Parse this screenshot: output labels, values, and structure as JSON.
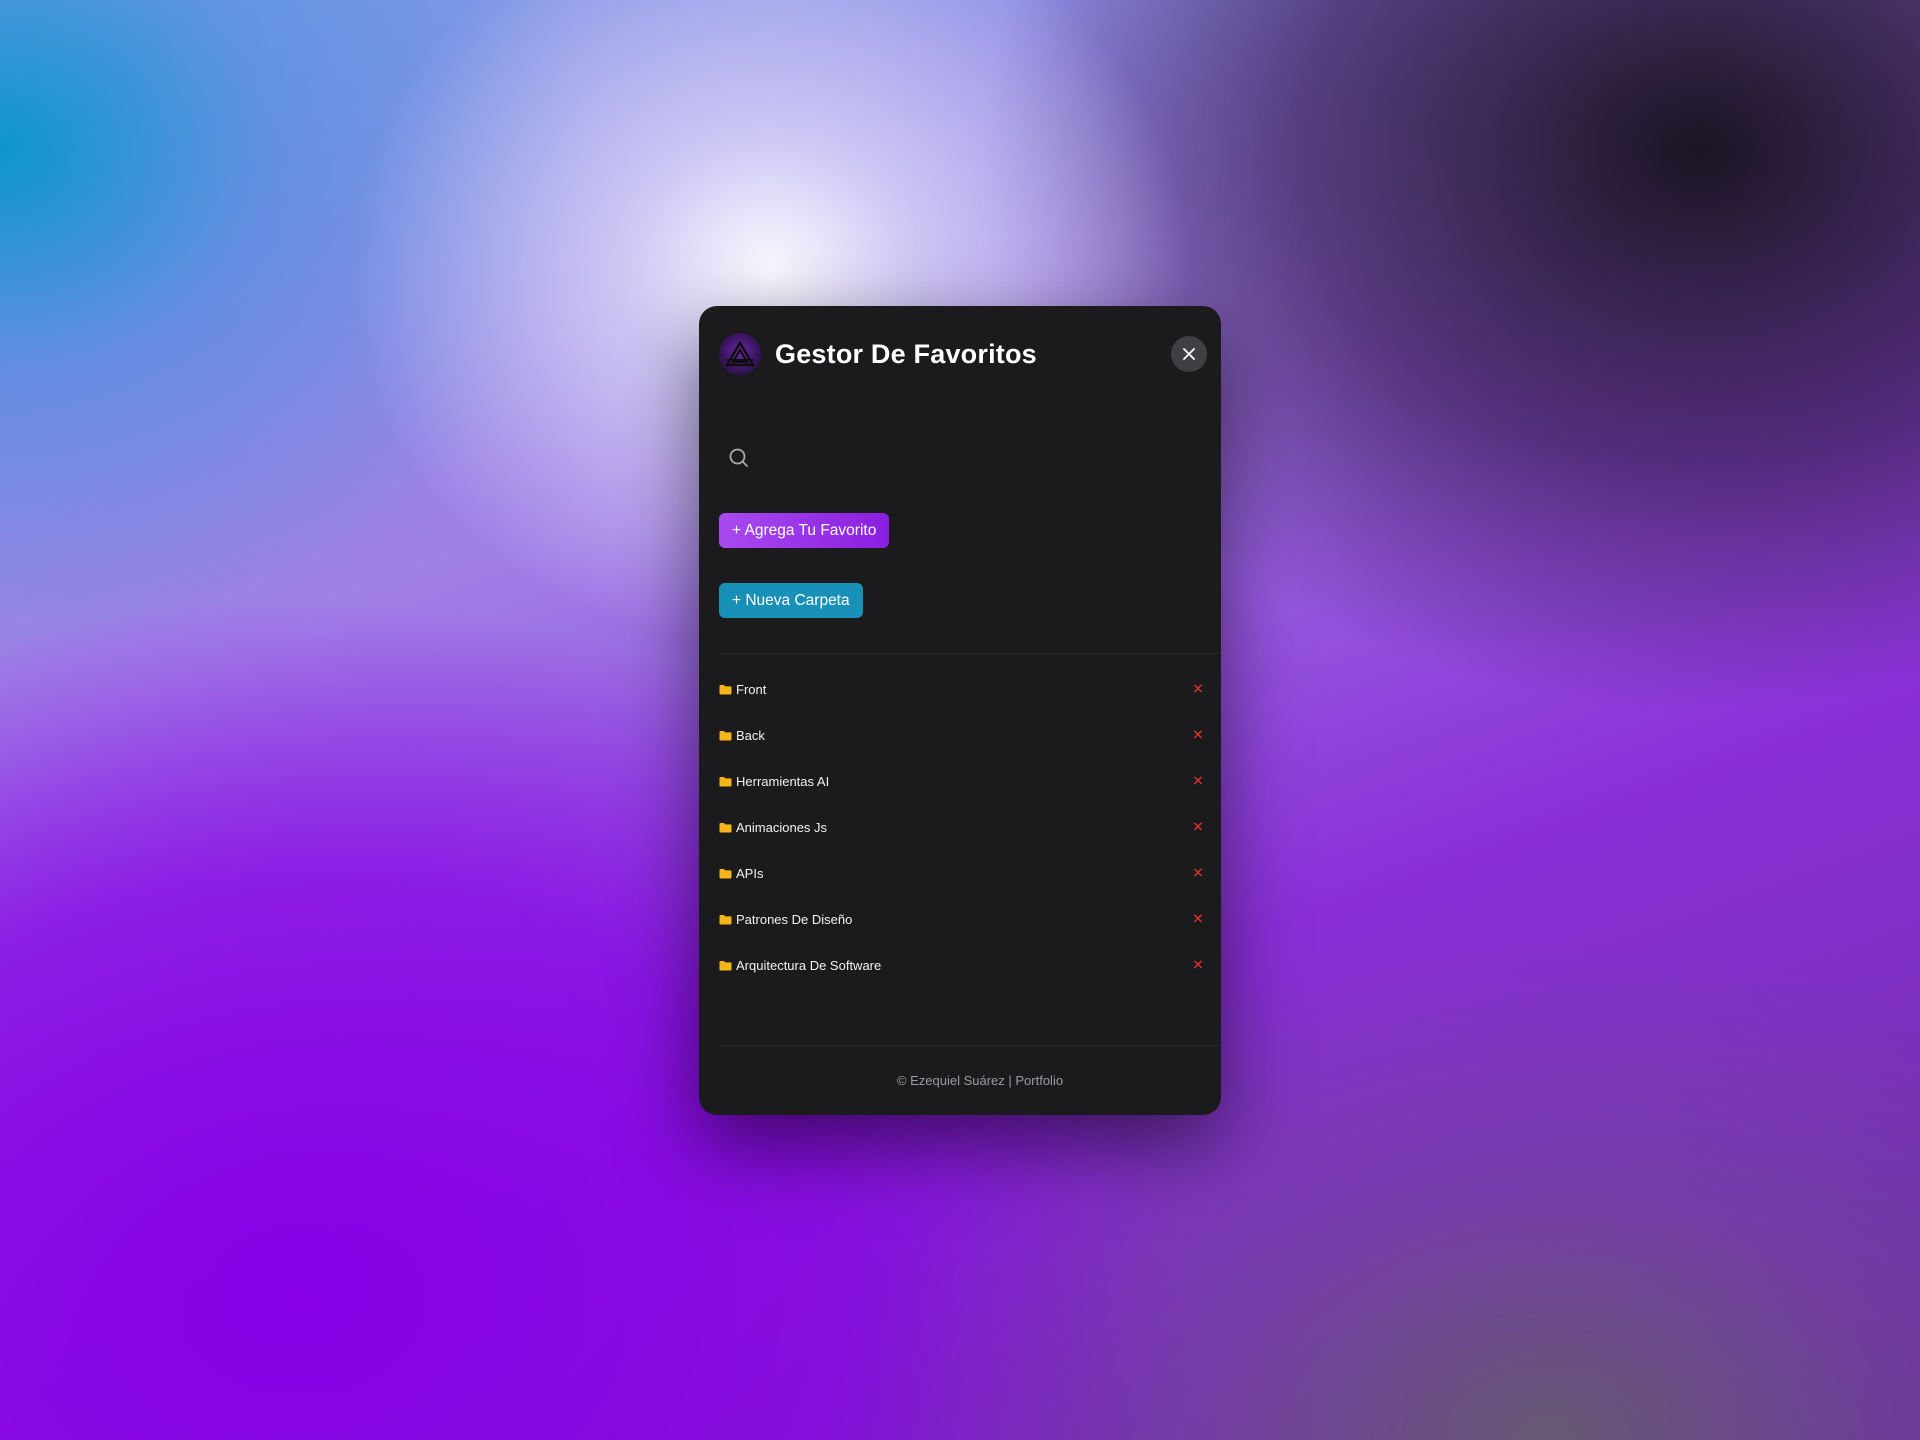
{
  "modal": {
    "title": "Gestor De Favoritos",
    "logo_icon": "triangle-logo-icon",
    "close_icon": "close-icon"
  },
  "search": {
    "placeholder": "",
    "value": "",
    "icon": "search-icon"
  },
  "actions": {
    "add_favorite_label": "+ Agrega Tu Favorito",
    "add_folder_label": "+ Nueva Carpeta"
  },
  "folders": [
    {
      "name": "Front"
    },
    {
      "name": "Back"
    },
    {
      "name": "Herramientas AI"
    },
    {
      "name": "Animaciones Js"
    },
    {
      "name": "APIs"
    },
    {
      "name": "Patrones De Diseño"
    },
    {
      "name": "Arquitectura De Software"
    }
  ],
  "folder_delete_label": "✕",
  "footer": {
    "copyright": "© Ezequiel Suárez",
    "separator": " | ",
    "link_label": "Portfolio"
  },
  "colors": {
    "modal_bg": "#1b1b1d",
    "favorite_button": "#9a33e8",
    "folder_button": "#1990b8",
    "delete": "#e0312f",
    "folder_icon": "#f4b41a"
  }
}
